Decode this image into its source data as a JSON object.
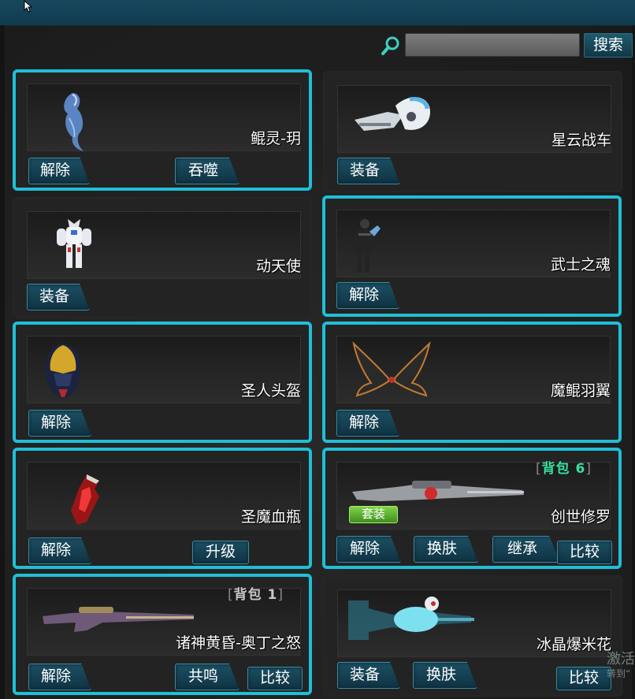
{
  "search": {
    "placeholder": "",
    "button_label": "搜索"
  },
  "items": [
    {
      "name": "鲲灵-玥",
      "active": true,
      "buttons": [
        "解除",
        "吞噬"
      ]
    },
    {
      "name": "星云战车",
      "active": false,
      "buttons": [
        "装备"
      ]
    },
    {
      "name": "动天使",
      "active": false,
      "buttons": [
        "装备"
      ]
    },
    {
      "name": "武士之魂",
      "active": true,
      "buttons": [
        "解除"
      ]
    },
    {
      "name": "圣人头盔",
      "active": true,
      "buttons": [
        "解除"
      ]
    },
    {
      "name": "魔鲲羽翼",
      "active": true,
      "buttons": [
        "解除"
      ]
    },
    {
      "name": "圣魔血瓶",
      "active": true,
      "buttons": [
        "解除",
        "升级"
      ]
    },
    {
      "name": "创世修罗",
      "active": true,
      "buttons": [
        "解除",
        "换肤",
        "继承",
        "比较"
      ],
      "bag_tag": "背包 6",
      "badge": "套装"
    },
    {
      "name": "诸神黄昏-奥丁之怒",
      "active": true,
      "buttons": [
        "解除",
        "共鸣",
        "比较"
      ],
      "bag_tag": "背包 1"
    },
    {
      "name": "冰晶爆米花",
      "active": false,
      "buttons": [
        "装备",
        "换肤",
        "比较"
      ]
    }
  ],
  "overlay": {
    "line1": "激活",
    "line2": "转到“"
  },
  "colors": {
    "accent": "#1fbfd6",
    "button_bg": "#123c4d",
    "topbar": "#154256",
    "badge_green": "#5cb33a"
  }
}
